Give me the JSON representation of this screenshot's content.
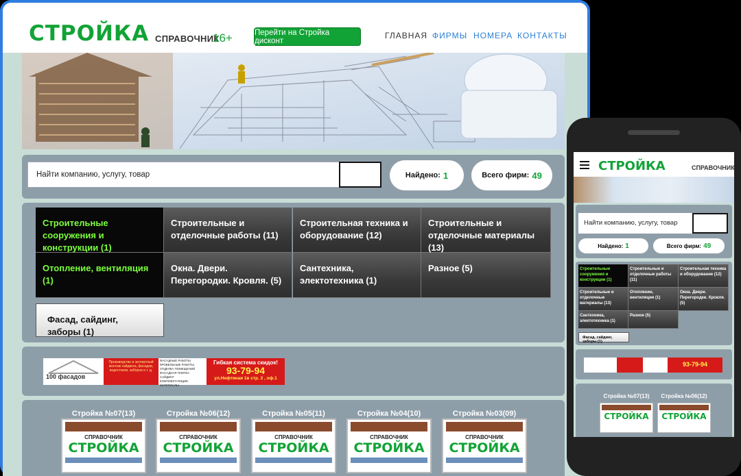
{
  "desktop": {
    "logo": "СТРОЙКА",
    "logo_sub": "СПРАВОЧНИК",
    "logo_age": "16+",
    "discount_button": "Перейти на Стройка дисконт",
    "nav": [
      {
        "label": "ГЛАВНАЯ",
        "color": "#333333"
      },
      {
        "label": "ФИРМЫ",
        "color": "#2a7fd4"
      },
      {
        "label": "НОМЕРА",
        "color": "#2a7fd4"
      },
      {
        "label": "КОНТАКТЫ",
        "color": "#2a7fd4"
      }
    ],
    "search_placeholder": "Найти компанию, услугу, товар",
    "found_label": "Найдено:",
    "found_value": "1",
    "total_label": "Всего фирм:",
    "total_value": "49",
    "categories": [
      "Строительные сооружения и конструкции (1)",
      "Строительные и отделочные работы (11)",
      "Строительная техника и оборудование (12)",
      "Строительные и отделочные материалы (13)",
      "Отопление, вентиляция (1)",
      "Окна. Двери. Перегородки. Кровля. (5)",
      "Сантехника, электотехника (1)",
      "Разное (5)",
      "Фасад, сайдинг, заборы (1)"
    ],
    "ad": {
      "brand": "100 фасадов",
      "tagline": "Производство и экспертный монтаж сайдинга, фасадов, водостоков, заборов и т. д.",
      "list": [
        "ФАСАДНЫЕ РАБОТЫ",
        "КРОВЕЛЬНЫЕ РАБОТЫ",
        "ОТДЕЛКА ПОМЕЩЕНИЙ",
        "ФАСАДНАЯ ПЛИТКА",
        "САЙДИНГ",
        "КОМПЛЕКТУЮЩИЕ МАТЕРИАЛЫ"
      ],
      "promo": "Гибкая система скидок!",
      "phone": "93-79-94",
      "address": "ул.Нефтяная 1в стр. 2 , оф.1"
    },
    "issues": [
      "Стройка №07(13)",
      "Стройка №06(12)",
      "Стройка №05(11)",
      "Стройка №04(10)",
      "Стройка №03(09)"
    ],
    "magazine_sub": "СПРАВОЧНИК",
    "magazine_title": "СТРОЙКА"
  },
  "mobile": {
    "logo": "СТРОЙКА",
    "logo_sub": "СПРАВОЧНИК",
    "search_placeholder": "Найти компанию, услугу, товар",
    "found_label": "Найдено:",
    "found_value": "1",
    "total_label": "Всего фирм:",
    "total_value": "49",
    "categories": [
      "Строительные сооружения и конструкции (1)",
      "Строительные и отделочные работы (11)",
      "Строительная техника и оборудование (12)",
      "Строительные и отделочные материалы (13)",
      "Отопление, вентиляция (1)",
      "Окна. Двери. Перегородки. Кровля. (5)",
      "Сантехника, электотехника (1)",
      "Разное (5)"
    ],
    "extra_category": "Фасад, сайдинг, заборы (1)",
    "ad_phone": "93-79-94",
    "issues": [
      "Стройка №07(13)",
      "Стройка №06(12)"
    ]
  },
  "colors": {
    "accent": "#12a336",
    "nav_blue": "#2a7fd4",
    "frame_blue": "#2f7de1",
    "panel": "#8e9ea9"
  }
}
